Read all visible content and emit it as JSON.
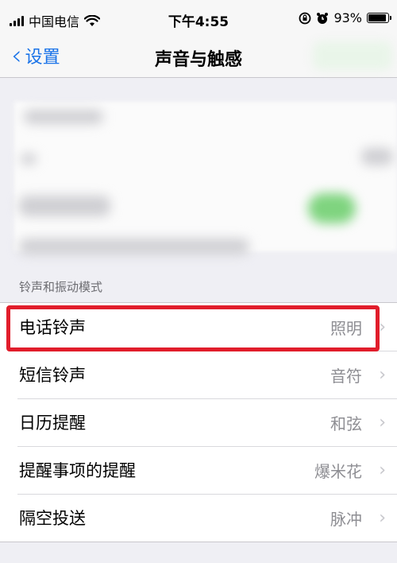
{
  "status_bar": {
    "carrier": "中国电信",
    "time": "下午4:55",
    "battery_text": "93%",
    "battery_level": 0.93,
    "icons": [
      "signal-icon",
      "wifi-icon",
      "rotation-lock-icon",
      "alarm-icon",
      "battery-icon"
    ]
  },
  "nav": {
    "back_label": "设置",
    "title": "声音与触感"
  },
  "section": {
    "header": "铃声和振动模式"
  },
  "rows": [
    {
      "label": "电话铃声",
      "value": "照明"
    },
    {
      "label": "短信铃声",
      "value": "音符"
    },
    {
      "label": "日历提醒",
      "value": "和弦"
    },
    {
      "label": "提醒事项的提醒",
      "value": "爆米花"
    },
    {
      "label": "隔空投送",
      "value": "脉冲"
    }
  ],
  "colors": {
    "accent": "#1a73e8",
    "highlight": "#e11d2b",
    "background": "#efeff4"
  }
}
